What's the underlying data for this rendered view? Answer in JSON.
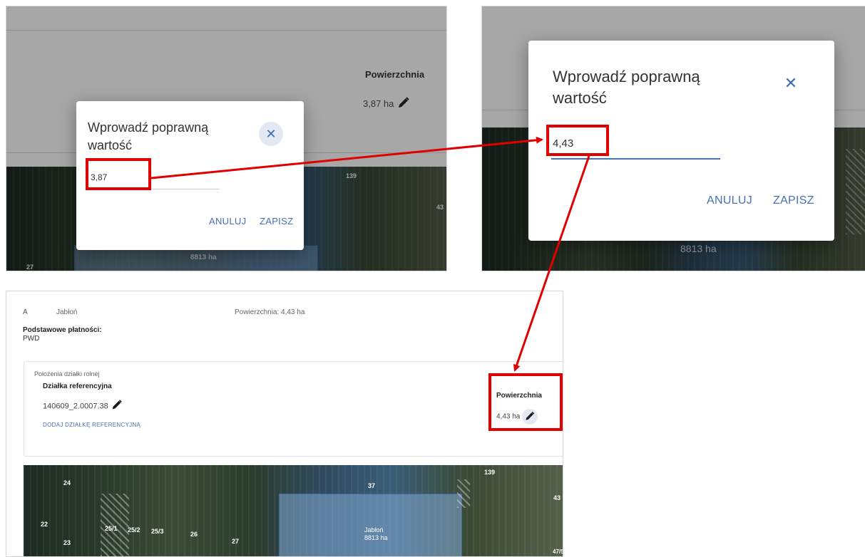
{
  "dialog": {
    "title_line1": "Wprowadź poprawną",
    "title_line2": "wartość",
    "cancel_label": "ANULUJ",
    "save_label": "ZAPISZ",
    "close_glyph": "✕"
  },
  "panel_before": {
    "input_value": "3,87",
    "area_heading": "Powierzchnia",
    "area_value": "3,87 ha",
    "map_ha": "8813 ha",
    "plot_139": "139",
    "plot_43": "43",
    "plot_27": "27"
  },
  "panel_edit": {
    "input_value": "4,43",
    "map_ha": "8813 ha"
  },
  "panel_after": {
    "row_letter": "A",
    "crop": "Jabłoń",
    "area_summary": "Powierzchnia: 4,43 ha",
    "payments_heading": "Podstawowe płatności:",
    "payments_value": "PWD",
    "location_label": "Położenia działki rolnej",
    "ref_plot_heading": "Działka referencyjna",
    "ref_plot_id": "140609_2.0007.38",
    "add_ref_link": "DODAJ DZIAŁKĘ REFERENCYJNĄ",
    "area_heading": "Powierzchnia",
    "area_value": "4,43 ha",
    "map_labels": {
      "p24": "24",
      "p37": "37",
      "p139": "139",
      "p43": "43",
      "p22": "22",
      "p23": "23",
      "p251": "25/1",
      "p252": "25/2",
      "p253": "25/3",
      "p26": "26",
      "p27": "27",
      "p475": "47/5",
      "crop": "Jabłoń",
      "ha": "8813 ha"
    }
  },
  "icons": [
    "close-icon",
    "pencil-icon"
  ],
  "colors": {
    "accent_blue": "#4670b4",
    "highlight_red": "#e00000",
    "overlay_grey": "#a7a7a7"
  }
}
